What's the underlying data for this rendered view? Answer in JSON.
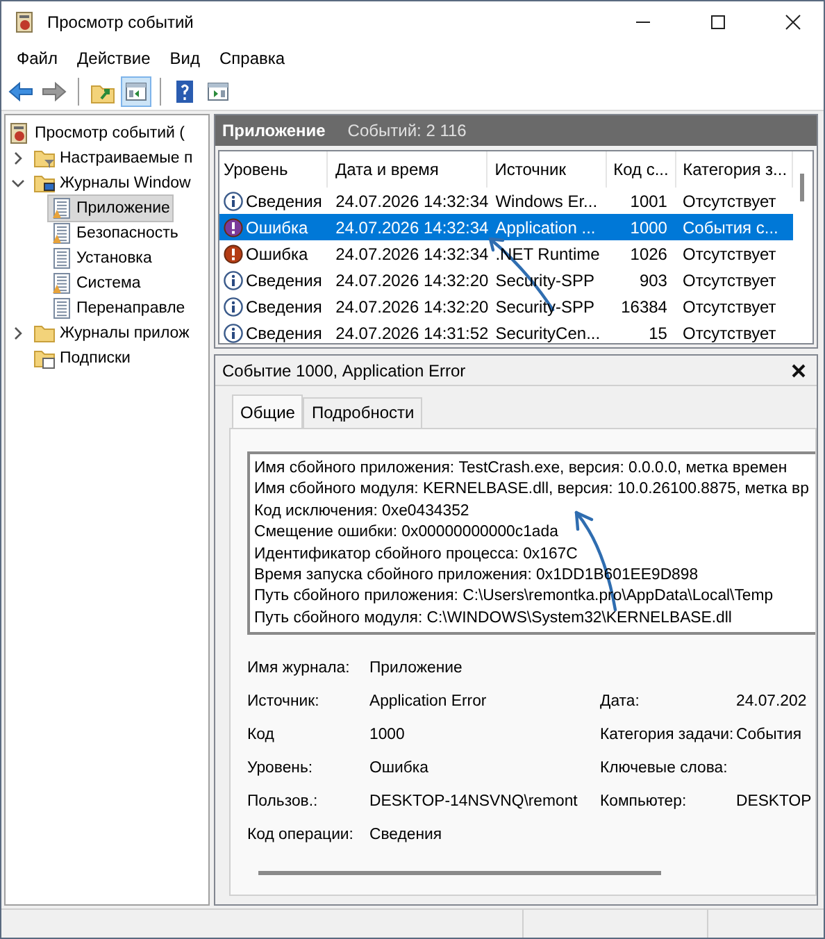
{
  "window": {
    "title": "Просмотр событий"
  },
  "menu": [
    "Файл",
    "Действие",
    "Вид",
    "Справка"
  ],
  "toolbar": [
    {
      "kind": "back",
      "on": false
    },
    {
      "kind": "forward",
      "on": false
    },
    {
      "kind": "up",
      "on": false
    },
    {
      "kind": "tree",
      "on": true
    },
    {
      "kind": "help",
      "on": false
    },
    {
      "kind": "actions",
      "on": false
    }
  ],
  "tree": {
    "label": "Просмотр событий (",
    "kind": "root",
    "selected": false,
    "children": [
      {
        "label": "Настраиваемые п",
        "kind": "folder-filter",
        "selected": false,
        "expanded": false
      },
      {
        "label": "Журналы Window",
        "kind": "folder-pc",
        "selected": false,
        "expanded": true,
        "children": [
          {
            "label": "Приложение",
            "kind": "log-warn",
            "selected": true
          },
          {
            "label": "Безопасность",
            "kind": "log-warn",
            "selected": false
          },
          {
            "label": "Установка",
            "kind": "log",
            "selected": false
          },
          {
            "label": "Система",
            "kind": "log-warn",
            "selected": false
          },
          {
            "label": "Перенаправле",
            "kind": "log",
            "selected": false
          }
        ]
      },
      {
        "label": "Журналы прилож",
        "kind": "folder",
        "selected": false,
        "expanded": false
      },
      {
        "label": "Подписки",
        "kind": "subscription",
        "selected": false
      }
    ]
  },
  "list": {
    "title": "Приложение",
    "count": "Событий: 2 116",
    "columns": [
      "Уровень",
      "Дата и время",
      "Источник",
      "Код с...",
      "Категория з..."
    ],
    "rows": [
      {
        "kind": "info",
        "level": "Сведения",
        "date": "24.07.2026 14:32:34",
        "source": "Windows Er...",
        "code": "1001",
        "category": "Отсутствует",
        "selected": false
      },
      {
        "kind": "error",
        "level": "Ошибка",
        "date": "24.07.2026 14:32:34",
        "source": "Application ...",
        "code": "1000",
        "category": "События с...",
        "selected": true
      },
      {
        "kind": "error",
        "level": "Ошибка",
        "date": "24.07.2026 14:32:34",
        "source": ".NET Runtime",
        "code": "1026",
        "category": "Отсутствует",
        "selected": false
      },
      {
        "kind": "info",
        "level": "Сведения",
        "date": "24.07.2026 14:32:20",
        "source": "Security-SPP",
        "code": "903",
        "category": "Отсутствует",
        "selected": false
      },
      {
        "kind": "info",
        "level": "Сведения",
        "date": "24.07.2026 14:32:20",
        "source": "Security-SPP",
        "code": "16384",
        "category": "Отсутствует",
        "selected": false
      },
      {
        "kind": "info",
        "level": "Сведения",
        "date": "24.07.2026 14:31:52",
        "source": "SecurityCen...",
        "code": "15",
        "category": "Отсутствует",
        "selected": false
      }
    ]
  },
  "detail": {
    "title": "Событие 1000, Application Error",
    "tabs": [
      {
        "label": "Общие",
        "selected": true
      },
      {
        "label": "Подробности",
        "selected": false
      }
    ],
    "description": [
      "Имя сбойного приложения: TestCrash.exe, версия: 0.0.0.0, метка времен",
      "Имя сбойного модуля: KERNELBASE.dll, версия: 10.0.26100.8875, метка вр",
      "Код исключения: 0xe0434352",
      "Смещение ошибки: 0x00000000000c1ada",
      "Идентификатор сбойного процесса: 0x167C",
      "Время запуска сбойного приложения: 0x1DD1B601EE9D898",
      "Путь сбойного приложения: C:\\Users\\remontka.pro\\AppData\\Local\\Temp",
      "Путь сбойного модуля: C:\\WINDOWS\\System32\\KERNELBASE.dll"
    ],
    "field_rows": [
      {
        "left": {
          "label": "Имя журнала:",
          "value": "Приложение"
        }
      },
      {
        "left": {
          "label": "Источник:",
          "value": "Application Error"
        },
        "right": {
          "label": "Дата:",
          "value": "24.07.202"
        }
      },
      {
        "left": {
          "label": "Код",
          "value": "1000"
        },
        "right": {
          "label": "Категория задачи:",
          "value": "События"
        }
      },
      {
        "left": {
          "label": "Уровень:",
          "value": "Ошибка"
        },
        "right": {
          "label": "Ключевые слова:"
        }
      },
      {
        "left": {
          "label": "Пользов.:",
          "value": "DESKTOP-14NSVNQ\\remont"
        },
        "right": {
          "label": "Компьютер:",
          "value": "DESKTOP"
        }
      },
      {
        "left": {
          "label": "Код операции:",
          "value": "Сведения"
        }
      }
    ]
  }
}
